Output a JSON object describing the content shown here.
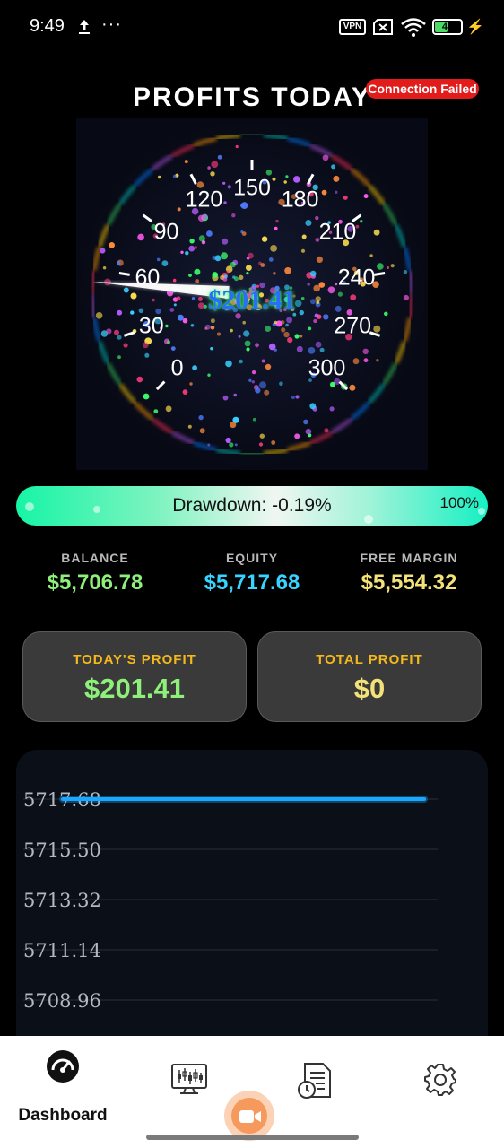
{
  "status_bar": {
    "time": "9:49",
    "dots": "···",
    "vpn_label": "VPN",
    "battery_level": "45",
    "battery_fraction": 0.45
  },
  "header": {
    "title": "PROFITS TODAY",
    "connection_badge": "Connection Failed",
    "badge_color": "#e21b1b"
  },
  "gauge": {
    "value_text": "$201.41",
    "ticks": [
      "0",
      "30",
      "60",
      "90",
      "120",
      "150",
      "180",
      "210",
      "240",
      "270",
      "300"
    ],
    "needle_value": 55
  },
  "drawdown": {
    "label": "Drawdown: -0.19%",
    "percent": "100%"
  },
  "stats": [
    {
      "label": "BALANCE",
      "value": "$5,706.78",
      "color": "#8ef07a"
    },
    {
      "label": "EQUITY",
      "value": "$5,717.68",
      "color": "#37d4ff"
    },
    {
      "label": "FREE MARGIN",
      "value": "$5,554.32",
      "color": "#f3e27a"
    }
  ],
  "cards": {
    "todays_profit": {
      "label": "TODAY'S PROFIT",
      "value": "$201.41",
      "color": "#8ef07a"
    },
    "total_profit": {
      "label": "TOTAL PROFIT",
      "value": "$0",
      "color": "#f3e27a"
    }
  },
  "chart_data": {
    "type": "line",
    "title": "",
    "xlabel": "",
    "ylabel": "",
    "y_ticks": [
      "5717.68",
      "5715.50",
      "5713.32",
      "5711.14",
      "5708.96"
    ],
    "ylim": [
      5708.96,
      5717.68
    ],
    "series": [
      {
        "values": [
          5717.68,
          5717.68
        ]
      }
    ],
    "grid": true,
    "line_color": "#1aa8ff"
  },
  "nav": {
    "dashboard_label": "Dashboard",
    "items": [
      "dashboard",
      "trading",
      "video",
      "history",
      "settings"
    ]
  }
}
